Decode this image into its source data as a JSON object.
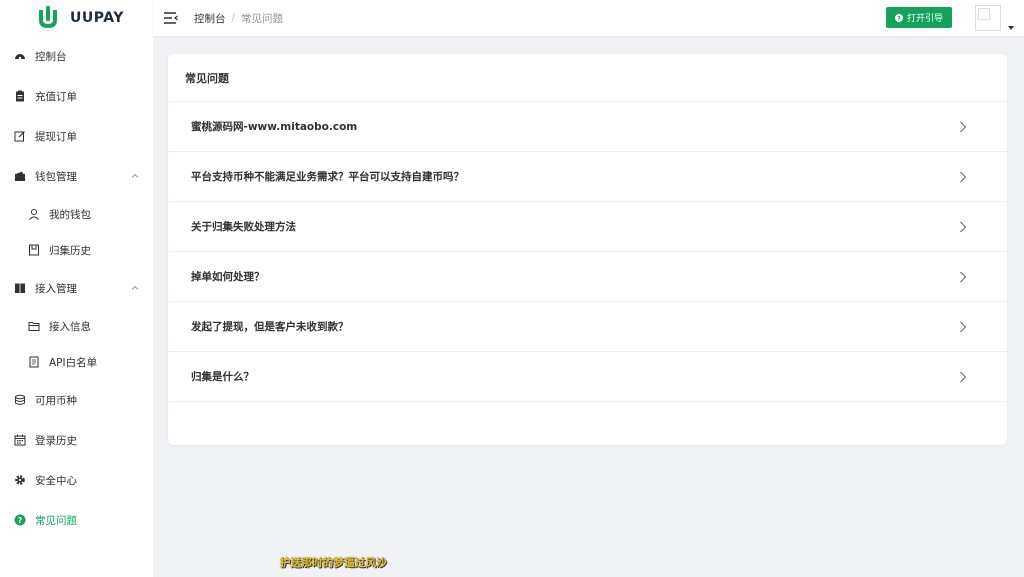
{
  "brand": {
    "name": "UUPAY",
    "color": "#13a35a"
  },
  "header": {
    "breadcrumb": {
      "root": "控制台",
      "separator": "/",
      "current": "常见问题"
    },
    "guide_button": "打开引导"
  },
  "sidebar": {
    "items": [
      {
        "label": "控制台",
        "icon": "dashboard-icon"
      },
      {
        "label": "充值订单",
        "icon": "clipboard-icon"
      },
      {
        "label": "提现订单",
        "icon": "edit-icon"
      },
      {
        "label": "钱包管理",
        "icon": "wallet-icon"
      },
      {
        "label": "我的钱包",
        "icon": "user-icon"
      },
      {
        "label": "归集历史",
        "icon": "document-icon"
      },
      {
        "label": "接入管理",
        "icon": "book-icon"
      },
      {
        "label": "接入信息",
        "icon": "folder-icon"
      },
      {
        "label": "API白名单",
        "icon": "list-icon"
      },
      {
        "label": "可用币种",
        "icon": "coins-icon"
      },
      {
        "label": "登录历史",
        "icon": "calendar-icon"
      },
      {
        "label": "安全中心",
        "icon": "gear-icon"
      },
      {
        "label": "常见问题",
        "icon": "question-icon"
      }
    ]
  },
  "main": {
    "card_title": "常见问题",
    "faq": [
      "蜜桃源码网-www.mitaobo.com",
      "平台支持币种不能满足业务需求？平台可以支持自建币吗？",
      "关于归集失败处理方法",
      "掉单如何处理？",
      "发起了提现，但是客户未收到款？",
      "归集是什么？"
    ]
  },
  "footer": {
    "text": "护送那时的梦逼过风沙"
  }
}
